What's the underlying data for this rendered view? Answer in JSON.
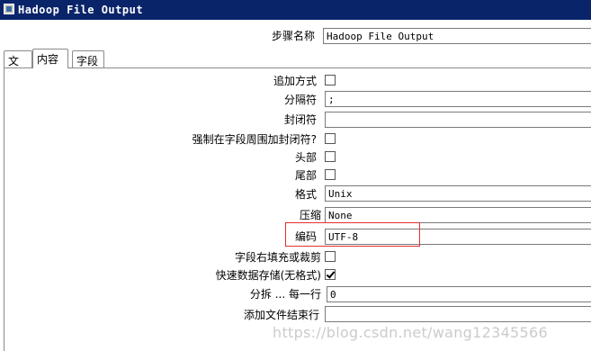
{
  "window": {
    "title": "Hadoop File Output"
  },
  "step": {
    "label": "步骤名称",
    "value": "Hadoop File Output"
  },
  "tabs": [
    {
      "label": "文件"
    },
    {
      "label": "内容"
    },
    {
      "label": "字段"
    }
  ],
  "active_tab": "内容",
  "content": {
    "append": {
      "label": "追加方式",
      "checked": false
    },
    "separator": {
      "label": "分隔符",
      "value": ";"
    },
    "enclosure": {
      "label": "封闭符",
      "value": ""
    },
    "force_enclosure": {
      "label": "强制在字段周围加封闭符?",
      "checked": false
    },
    "header": {
      "label": "头部",
      "checked": false
    },
    "footer": {
      "label": "尾部",
      "checked": false
    },
    "format": {
      "label": "格式",
      "value": "Unix"
    },
    "compression": {
      "label": "压缩",
      "value": "None"
    },
    "encoding": {
      "label": "编码",
      "value": "UTF-8"
    },
    "pad_fields": {
      "label": "字段右填充或裁剪",
      "checked": false
    },
    "fast_dump": {
      "label": "快速数据存储(无格式)",
      "checked": true
    },
    "split_every": {
      "label": "分拆 ... 每一行",
      "value": "0"
    },
    "add_ending_line": {
      "label": "添加文件结束行",
      "value": ""
    }
  },
  "watermark": "https://blog.csdn.net/wang12345566",
  "colors": {
    "titlebar": "#0a246a",
    "highlight": "#e03030"
  }
}
